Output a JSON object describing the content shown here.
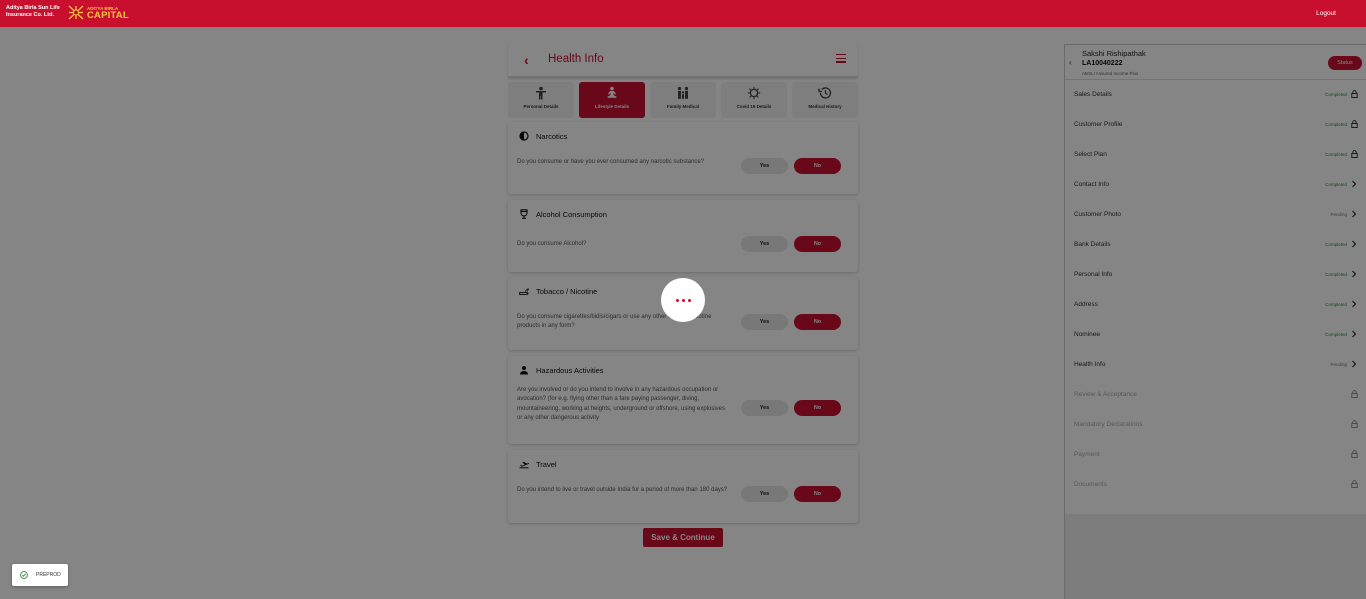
{
  "header": {
    "logo_text": "Aditya Birla Sun Life Insurance Co. Ltd.",
    "capital_small": "ADITYA BIRLA",
    "capital_big": "CAPITAL",
    "logout": "Logout"
  },
  "page": {
    "back_icon": "chevron-left-icon",
    "title": "Health Info",
    "menu_icon": "hamburger-icon"
  },
  "tabs": [
    {
      "label": "Personal Details",
      "icon": "person-icon",
      "active": false
    },
    {
      "label": "Lifestyle Details",
      "icon": "meditation-icon",
      "active": true
    },
    {
      "label": "Family Medical",
      "icon": "family-icon",
      "active": false
    },
    {
      "label": "Covid 19 Details",
      "icon": "virus-icon",
      "active": false
    },
    {
      "label": "Medical History",
      "icon": "history-icon",
      "active": false
    }
  ],
  "sections": [
    {
      "title": "Narcotics",
      "icon": "contrast-icon",
      "question": "Do you consume or have you ever consumed any narcotic substance?",
      "yes": "Yes",
      "no": "No",
      "selected": "No"
    },
    {
      "title": "Alcohol Consumption",
      "icon": "glass-icon",
      "question": "Do you consume Alcohol?",
      "yes": "Yes",
      "no": "No",
      "selected": "No"
    },
    {
      "title": "Tobacco / Nicotine",
      "icon": "smoking-icon",
      "question": "Do you consume cigarettes/bidis/cigars or use any other tobacco/nicotine products in any form?",
      "yes": "Yes",
      "no": "No",
      "selected": "No"
    },
    {
      "title": "Hazardous Activities",
      "icon": "person-hazard-icon",
      "question": "Are you involved or do you intend to involve in any hazardous occupation or avocation? (for e.g. flying other than a fare paying passenger, diving, mountaineering, working at heights, underground or offshore, using explosives or any other dangerous activity",
      "yes": "Yes",
      "no": "No",
      "selected": "No"
    },
    {
      "title": "Travel",
      "icon": "flight-icon",
      "question": "Do you intend to live or travel outside India for a period of more than 180 days?",
      "yes": "Yes",
      "no": "No",
      "selected": "No"
    }
  ],
  "save_button": "Save & Continue",
  "right_panel": {
    "name": "Sakshi Rishipathak",
    "application_number": "LA10040222",
    "plan": "ABSLI Assured Income Plus",
    "status_button": "Status",
    "items": [
      {
        "label": "Sales Details",
        "status": "Completed",
        "state": "completed",
        "icon": "lock-icon"
      },
      {
        "label": "Customer Profile",
        "status": "Completed",
        "state": "completed",
        "icon": "lock-icon"
      },
      {
        "label": "Select Plan",
        "status": "Completed",
        "state": "completed",
        "icon": "lock-icon"
      },
      {
        "label": "Contact Info",
        "status": "Completed",
        "state": "completed",
        "icon": "chevron-right-icon"
      },
      {
        "label": "Customer Photo",
        "status": "Pending",
        "state": "pending",
        "icon": "chevron-right-icon"
      },
      {
        "label": "Bank Details",
        "status": "Completed",
        "state": "completed",
        "icon": "chevron-right-icon"
      },
      {
        "label": "Personal Info",
        "status": "Completed",
        "state": "completed",
        "icon": "chevron-right-icon"
      },
      {
        "label": "Address",
        "status": "Completed",
        "state": "completed",
        "icon": "chevron-right-icon"
      },
      {
        "label": "Nominee",
        "status": "Completed",
        "state": "completed",
        "icon": "chevron-right-icon"
      },
      {
        "label": "Health Info",
        "status": "Pending",
        "state": "pending",
        "icon": "chevron-right-icon"
      },
      {
        "label": "Review & Acceptance",
        "status": "",
        "state": "locked",
        "icon": "lock-icon"
      },
      {
        "label": "Mandatory Declarations",
        "status": "",
        "state": "locked",
        "icon": "lock-icon"
      },
      {
        "label": "Payment",
        "status": "",
        "state": "locked",
        "icon": "lock-icon"
      },
      {
        "label": "Documents",
        "status": "",
        "state": "locked",
        "icon": "lock-icon"
      }
    ]
  },
  "toast": {
    "text": "PREPROD",
    "icon": "check-circle-icon"
  },
  "colors": {
    "brand": "#c8102e",
    "gold": "#f6c443",
    "completed": "#2e8b3e"
  }
}
